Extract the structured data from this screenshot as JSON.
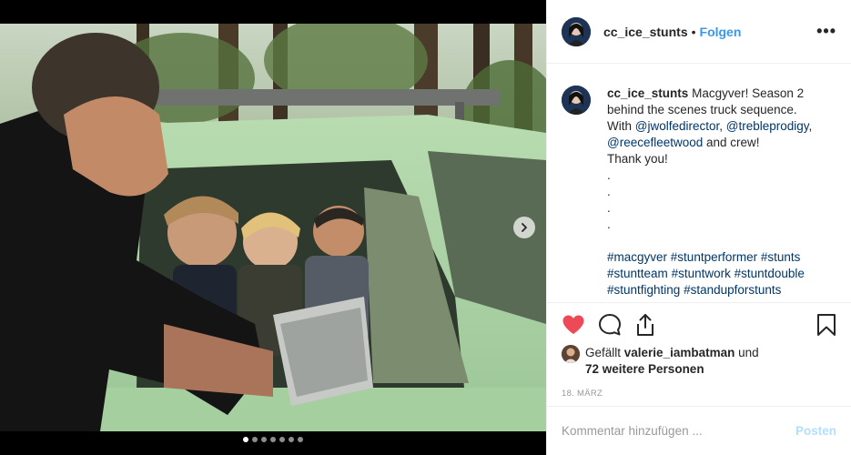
{
  "post": {
    "username": "cc_ice_stunts",
    "separator": "•",
    "follow_label": "Folgen",
    "more_label": "•••"
  },
  "caption": {
    "username": "cc_ice_stunts",
    "line1": "Macgyver! Season 2",
    "line2": "behind the scenes truck sequence.",
    "line3_prefix": "With ",
    "mention1": "@jwolfedirector",
    "comma1": ", ",
    "mention2": "@trebleprodigy",
    "comma2": ",",
    "mention3": "@reecefleetwood",
    "line4_suffix": " and crew!",
    "line5": "Thank you!",
    "dots": [
      ".",
      ".",
      ".",
      "."
    ],
    "hashtags": [
      "#macgyver",
      "#stuntperformer",
      "#stunts",
      "#stuntteam",
      "#stuntwork",
      "#stuntdouble",
      "#stuntfighting",
      "#standupforstunts"
    ]
  },
  "likes": {
    "prefix": "Gefällt ",
    "user": "valerie_iambatman",
    "middle": " und",
    "others": "72 weitere Personen"
  },
  "date": "18. MÄRZ",
  "comment": {
    "placeholder": "Kommentar hinzufügen ...",
    "post_label": "Posten"
  },
  "carousel": {
    "dot_count": 7,
    "active_index": 0
  },
  "icons": {
    "heart": "heart-icon",
    "comment": "comment-icon",
    "share": "share-icon",
    "bookmark": "bookmark-icon",
    "next": "chevron-right-icon"
  },
  "colors": {
    "heart": "#ed4956",
    "link": "#3897f0",
    "hashtag": "#003569",
    "post_disabled": "#b2dffc"
  }
}
